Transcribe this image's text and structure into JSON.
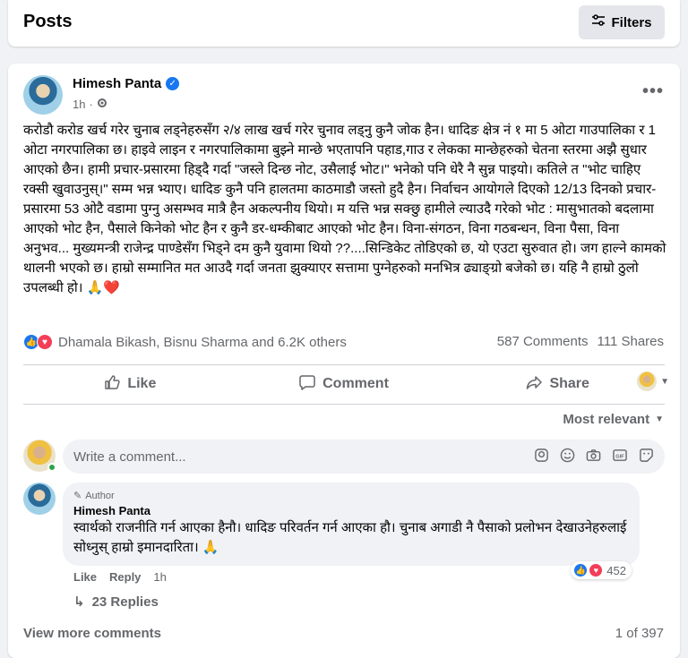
{
  "header": {
    "title": "Posts",
    "filters_label": "Filters"
  },
  "post": {
    "author": "Himesh Panta",
    "time": "1h",
    "body": "करोडौ करोड खर्च गरेर चुनाब लड्नेहरुसँग २/४ लाख खर्च गरेर चुनाव लड्नु कुनै जोक हैन। धादिङ क्षेत्र नं १ मा 5 ओटा गाउपालिका र 1 ओटा नगरपालिका छ। हाइवे लाइन र नगरपालिकामा बुझ्ने मान्छे भएतापनि पहाड,गाउ र लेकका मान्छेहरुको चेतना स्तरमा अझै सुधार आएको छैन। हामी प्रचार-प्रसारमा हिड्दै गर्दा \"जस्ले दिन्छ नोट, उसैलाई भोट।\" भनेको पनि धेरै नै सुन्न पाइयो। कतिले त \"भोट चाहिए रक्सी खुवाउनुस्।\" सम्म भन्न भ्याए। धादिङ कुनै पनि हालतमा काठमाडौ जस्तो हुदै हैन। निर्वाचन आयोगले दिएको 12/13 दिनको प्रचार-प्रसारमा 53 ओटै वडामा पुग्नु असम्भव मात्रै हैन अकल्पनीय थियो। म यत्ति भन्न सक्छु हामीले ल्याउदै गरेको भोट : मासुभातको बदलामा आएको भोट हैन, पैसाले किनेको भोट हैन र कुनै डर-धम्कीबाट आएको भोट हैन। विना-संगठन, विना गठबन्धन, विना पैसा, विना अनुभव... मुख्यमन्त्री राजेन्द्र पाण्डेसँग भिड्ने दम कुनै युवामा थियो ??....सिन्डिकेट तोडिएको छ, यो एउटा सुरुवात हो। जग हाल्ने कामको थालनी भएको छ। हाम्रो सम्मानित मत आउदै गर्दा जनता झुक्याएर सत्तामा पुग्नेहरुको मनभित्र ढ्याङ्ग्रो बजेको छ। यहि नै हाम्रो ठुलो उपलब्धी हो। 🙏❤️",
    "reactions_text": "Dhamala Bikash, Bisnu Sharma and 6.2K others",
    "comments_count": "587 Comments",
    "shares_count": "111 Shares",
    "actions": {
      "like": "Like",
      "comment": "Comment",
      "share": "Share"
    },
    "sort_label": "Most relevant",
    "comment_placeholder": "Write a comment...",
    "top_comment": {
      "badge": "Author",
      "name": "Himesh Panta",
      "text": "स्वार्थको राजनीति गर्न आएका हैनौ। धादिङ परिवर्तन गर्न आएका हौ। चुनाब अगाडी नै पैसाको प्रलोभन देखाउनेहरुलाई सोध्नुस् हाम्रो इमानदारिता। 🙏",
      "reaction_count": "452",
      "like": "Like",
      "reply": "Reply",
      "time": "1h",
      "replies": "23 Replies"
    },
    "view_more": "View more comments",
    "page_count": "1 of 397"
  }
}
